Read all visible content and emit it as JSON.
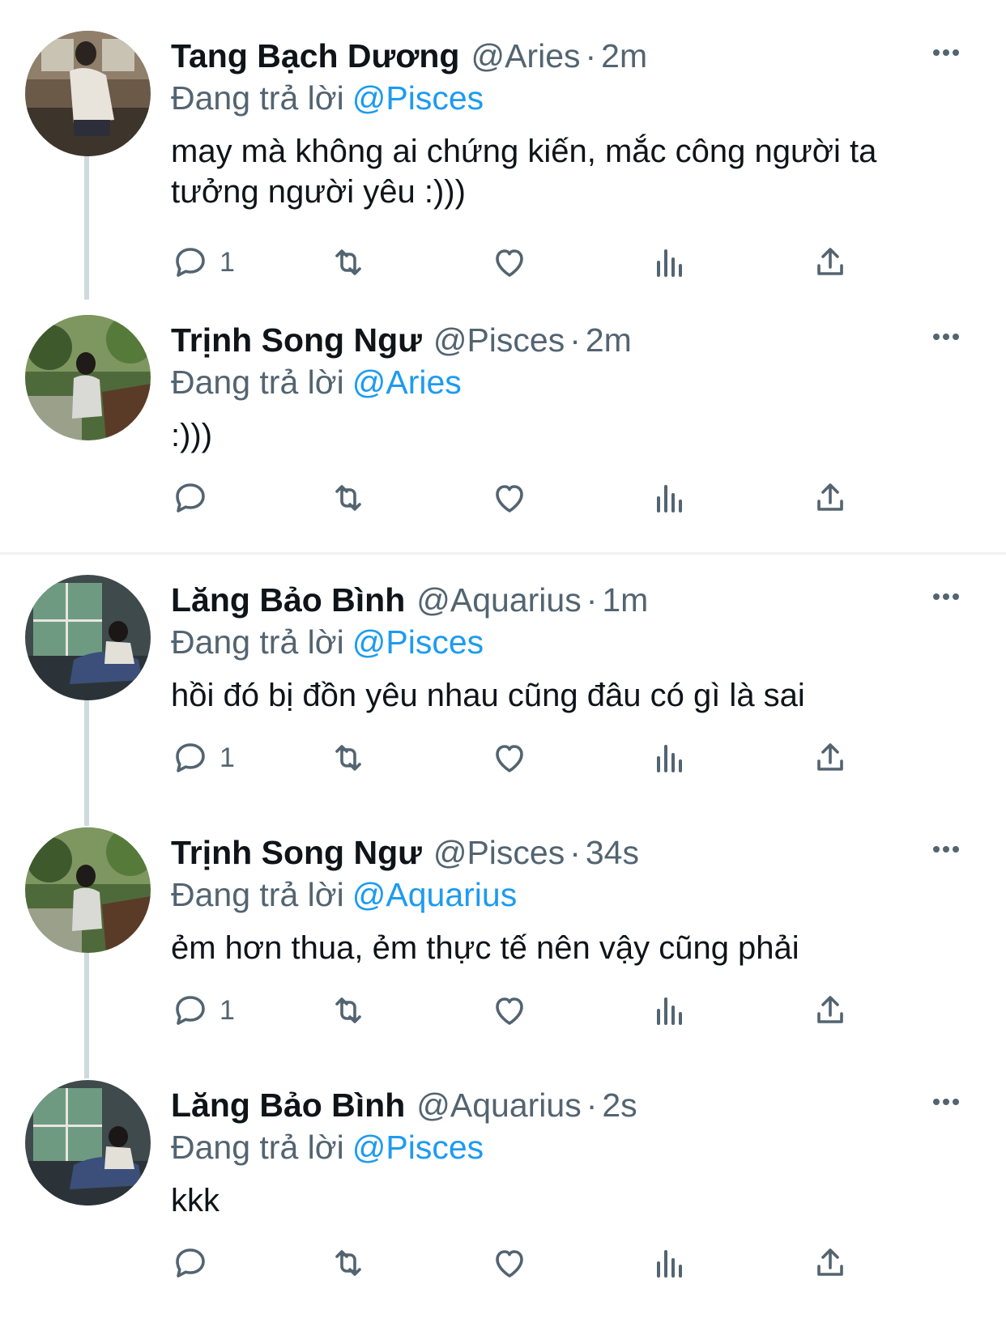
{
  "colors": {
    "link": "#1d9bf0",
    "secondary": "#536471",
    "thread_line": "#cfd9de"
  },
  "icons": [
    "reply-icon",
    "retweet-icon",
    "like-icon",
    "views-icon",
    "share-icon",
    "more-icon"
  ],
  "tweets": [
    {
      "name": "Tang Bạch Dương",
      "handle": "@Aries",
      "time": "2m",
      "replying_prefix": "Đang trả lời",
      "replying_to": "@Pisces",
      "text": "may mà không ai chứng kiến, mắc công người ta tưởng người yêu :)))",
      "reply_count": "1"
    },
    {
      "name": "Trịnh Song Ngư",
      "handle": "@Pisces",
      "time": "2m",
      "replying_prefix": "Đang trả lời",
      "replying_to": "@Aries",
      "text": ":)))",
      "reply_count": ""
    },
    {
      "name": "Lăng Bảo Bình",
      "handle": "@Aquarius",
      "time": "1m",
      "replying_prefix": "Đang trả lời",
      "replying_to": "@Pisces",
      "text": "hồi đó bị đồn yêu nhau cũng đâu có gì là sai",
      "reply_count": "1"
    },
    {
      "name": "Trịnh Song Ngư",
      "handle": "@Pisces",
      "time": "34s",
      "replying_prefix": "Đang trả lời",
      "replying_to": "@Aquarius",
      "text": "ẻm hơn thua, ẻm thực tế nên vậy cũng phải",
      "reply_count": "1"
    },
    {
      "name": "Lăng Bảo Bình",
      "handle": "@Aquarius",
      "time": "2s",
      "replying_prefix": "Đang trả lời",
      "replying_to": "@Pisces",
      "text": "kkk",
      "reply_count": ""
    }
  ]
}
